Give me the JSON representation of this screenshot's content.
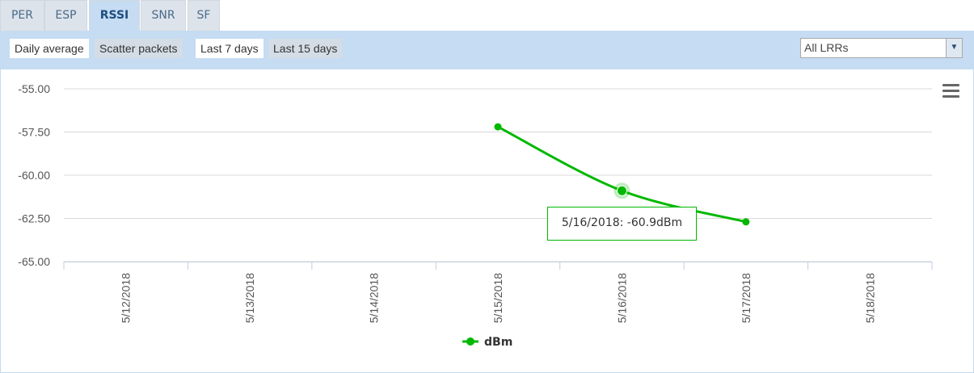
{
  "tabs": [
    {
      "label": "PER",
      "active": false
    },
    {
      "label": "ESP",
      "active": false
    },
    {
      "label": "RSSI",
      "active": true
    },
    {
      "label": "SNR",
      "active": false
    },
    {
      "label": "SF",
      "active": false
    }
  ],
  "toolbar": {
    "mode_buttons": [
      {
        "label": "Daily average",
        "selected": true
      },
      {
        "label": "Scatter packets",
        "selected": false
      }
    ],
    "range_buttons": [
      {
        "label": "Last 7 days",
        "selected": true
      },
      {
        "label": "Last 15 days",
        "selected": false
      }
    ],
    "lrr_select": {
      "value": "All LRRs"
    }
  },
  "colors": {
    "series": "#00b800",
    "tab_active_bg": "#c5dcf2",
    "toolbar_bg": "#c5dcf2"
  },
  "chart_data": {
    "type": "line",
    "categories": [
      "5/12/2018",
      "5/13/2018",
      "5/14/2018",
      "5/15/2018",
      "5/16/2018",
      "5/17/2018",
      "5/18/2018"
    ],
    "series": [
      {
        "name": "dBm",
        "values": [
          null,
          null,
          null,
          -57.2,
          -60.9,
          -62.7,
          null
        ]
      }
    ],
    "yticks": [
      "-55.00",
      "-57.50",
      "-60.00",
      "-62.50",
      "-65.00"
    ],
    "ylim": [
      -65,
      -55
    ],
    "grid": true,
    "legend_position": "bottom-center",
    "tooltip": {
      "category": "5/16/2018",
      "text": "5/16/2018: -60.9dBm"
    },
    "highlighted_index": 4
  },
  "icons": {
    "chart_menu": "hamburger-menu-icon",
    "select_arrow": "chevron-down-icon"
  }
}
